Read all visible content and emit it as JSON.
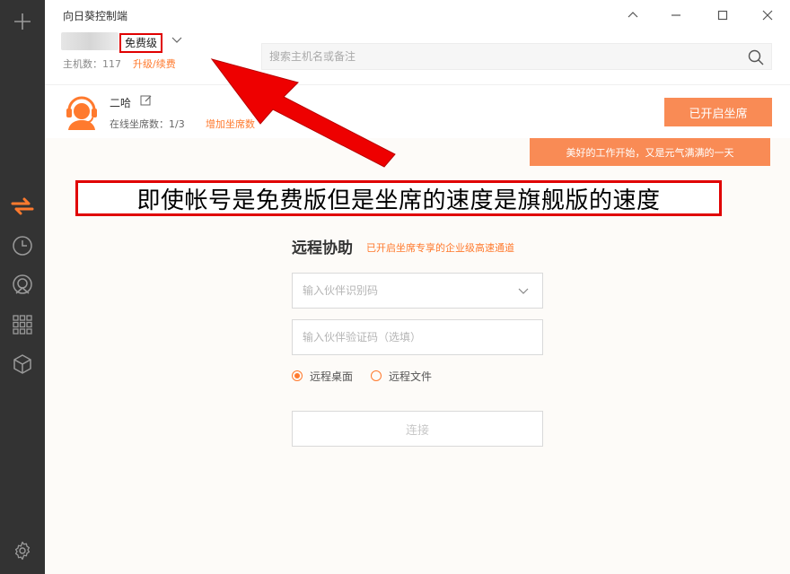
{
  "app": {
    "title": "向日葵控制端"
  },
  "account": {
    "plan": "免费级",
    "host_count": "主机数：117",
    "upgrade": "升级/续费"
  },
  "search": {
    "placeholder": "搜索主机名或备注"
  },
  "seat": {
    "name": "二哈",
    "online": "在线坐席数：1/3",
    "add": "增加坐席数",
    "button": "已开启坐席"
  },
  "banner": "美好的工作开始，又是元气满满的一天",
  "annotation": "即使帐号是免费版但是坐席的速度是旗舰版的速度",
  "remote": {
    "title": "远程协助",
    "subtitle": "已开启坐席专享的企业级高速通道",
    "partner_id_placeholder": "输入伙伴识别码",
    "partner_code_placeholder": "输入伙伴验证码（选填）",
    "options": [
      {
        "label": "远程桌面",
        "selected": true
      },
      {
        "label": "远程文件",
        "selected": false
      }
    ],
    "connect": "连接"
  },
  "icons": {
    "sidebar": [
      "plus-icon",
      "transfer-icon",
      "history-icon",
      "remote-camera-icon",
      "apps-grid-icon",
      "cube-icon",
      "settings-gear-icon"
    ]
  },
  "colors": {
    "accent": "#f98b55",
    "link": "#ff7a2e",
    "sidebar": "#333333",
    "annotation_border": "#e00000"
  }
}
